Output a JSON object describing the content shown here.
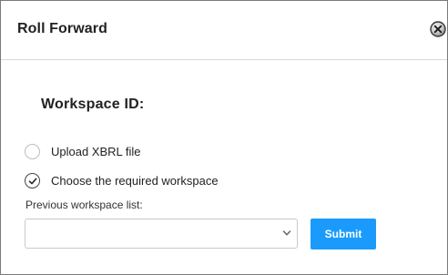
{
  "dialog": {
    "title": "Roll Forward",
    "close_icon": "close-circle-icon"
  },
  "form": {
    "heading": "Workspace ID:",
    "options": [
      {
        "label": "Upload XBRL file",
        "selected": false
      },
      {
        "label": "Choose the required workspace",
        "selected": true
      }
    ],
    "workspace_list": {
      "label": "Previous workspace list:",
      "selected_value": "",
      "dropdown_icon": "chevron-down-icon"
    },
    "submit_label": "Submit"
  },
  "colors": {
    "submit_bg": "#1a9bfc",
    "border": "#7a7a7a"
  }
}
